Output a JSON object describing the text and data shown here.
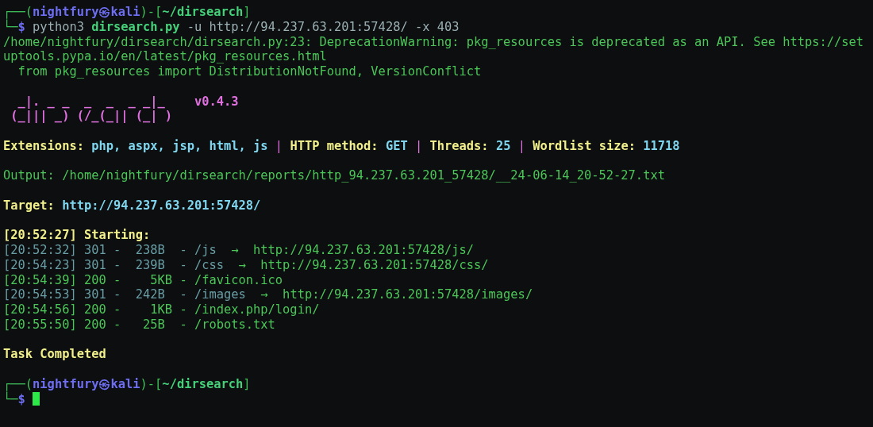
{
  "terminal": {
    "blocks": [
      [
        {
          "segments": [
            {
              "text": "┌──(",
              "kind": "frame"
            },
            {
              "text": "nightfury㉿kali",
              "kind": "user"
            },
            {
              "text": ")-[",
              "kind": "frame"
            },
            {
              "text": "~/dirsearch",
              "kind": "path"
            },
            {
              "text": "]",
              "kind": "frame"
            }
          ]
        },
        {
          "segments": [
            {
              "text": "└─",
              "kind": "frame"
            },
            {
              "text": "$",
              "kind": "dollar"
            },
            {
              "text": " python3 ",
              "kind": "plain"
            },
            {
              "text": "dirsearch.py",
              "kind": "exe"
            },
            {
              "text": " -u http://94.237.63.201:57428/ -x 403",
              "kind": "plain"
            }
          ]
        },
        {
          "segments": [
            {
              "text": "/home/nightfury/dirsearch/dirsearch.py:23: DeprecationWarning: pkg_resources is deprecated as an API. See https://set",
              "kind": "green"
            }
          ]
        },
        {
          "segments": [
            {
              "text": "uptools.pypa.io/en/latest/pkg_resources.html",
              "kind": "green"
            }
          ]
        },
        {
          "segments": [
            {
              "text": "  from pkg_resources import DistributionNotFound, VersionConflict",
              "kind": "green"
            }
          ]
        }
      ],
      [
        {
          "segments": [
            {
              "text": "  _|. _ _  _  _  _ _|_    v0.4.3",
              "kind": "banner"
            }
          ]
        },
        {
          "segments": [
            {
              "text": " (_||| _) (/_(_|| (_| )",
              "kind": "banner"
            }
          ]
        }
      ],
      [
        {
          "segments": [
            {
              "text": "Extensions: ",
              "kind": "label"
            },
            {
              "text": "php, aspx, jsp, html, js",
              "kind": "value"
            },
            {
              "text": " | ",
              "kind": "sep"
            },
            {
              "text": "HTTP method: ",
              "kind": "label"
            },
            {
              "text": "GET",
              "kind": "value"
            },
            {
              "text": " | ",
              "kind": "sep"
            },
            {
              "text": "Threads: ",
              "kind": "label"
            },
            {
              "text": "25",
              "kind": "value"
            },
            {
              "text": " | ",
              "kind": "sep"
            },
            {
              "text": "Wordlist size: ",
              "kind": "label"
            },
            {
              "text": "11718",
              "kind": "value"
            }
          ]
        }
      ],
      [
        {
          "segments": [
            {
              "text": "Output: /home/nightfury/dirsearch/reports/http_94.237.63.201_57428/__24-06-14_20-52-27.txt",
              "kind": "green"
            }
          ]
        }
      ],
      [
        {
          "segments": [
            {
              "text": "Target: ",
              "kind": "label"
            },
            {
              "text": "http://94.237.63.201:57428/",
              "kind": "value"
            }
          ]
        }
      ],
      [
        {
          "segments": [
            {
              "text": "[20:52:27] Starting:",
              "kind": "label"
            }
          ]
        },
        {
          "segments": [
            {
              "text": "[20:52:32] 301 -  238B  - /js  ",
              "kind": "redirect"
            },
            {
              "text": "→  http://94.237.63.201:57428/js/",
              "kind": "green"
            }
          ]
        },
        {
          "segments": [
            {
              "text": "[20:54:23] 301 -  239B  - /css  ",
              "kind": "redirect"
            },
            {
              "text": "→  http://94.237.63.201:57428/css/",
              "kind": "green"
            }
          ]
        },
        {
          "segments": [
            {
              "text": "[20:54:39] 200 -    5KB - /favicon.ico",
              "kind": "green"
            }
          ]
        },
        {
          "segments": [
            {
              "text": "[20:54:53] 301 -  242B  - /images  ",
              "kind": "redirect"
            },
            {
              "text": "→  http://94.237.63.201:57428/images/",
              "kind": "green"
            }
          ]
        },
        {
          "segments": [
            {
              "text": "[20:54:56] 200 -    1KB - /index.php/login/",
              "kind": "green"
            }
          ]
        },
        {
          "segments": [
            {
              "text": "[20:55:50] 200 -   25B  - /robots.txt",
              "kind": "green"
            }
          ]
        }
      ],
      [
        {
          "segments": [
            {
              "text": "Task Completed",
              "kind": "label"
            }
          ]
        }
      ],
      [
        {
          "segments": [
            {
              "text": "┌──(",
              "kind": "frame"
            },
            {
              "text": "nightfury㉿kali",
              "kind": "user"
            },
            {
              "text": ")-[",
              "kind": "frame"
            },
            {
              "text": "~/dirsearch",
              "kind": "path"
            },
            {
              "text": "]",
              "kind": "frame"
            }
          ]
        },
        {
          "cursor": true,
          "segments": [
            {
              "text": "└─",
              "kind": "frame"
            },
            {
              "text": "$",
              "kind": "dollar"
            }
          ]
        }
      ]
    ]
  }
}
